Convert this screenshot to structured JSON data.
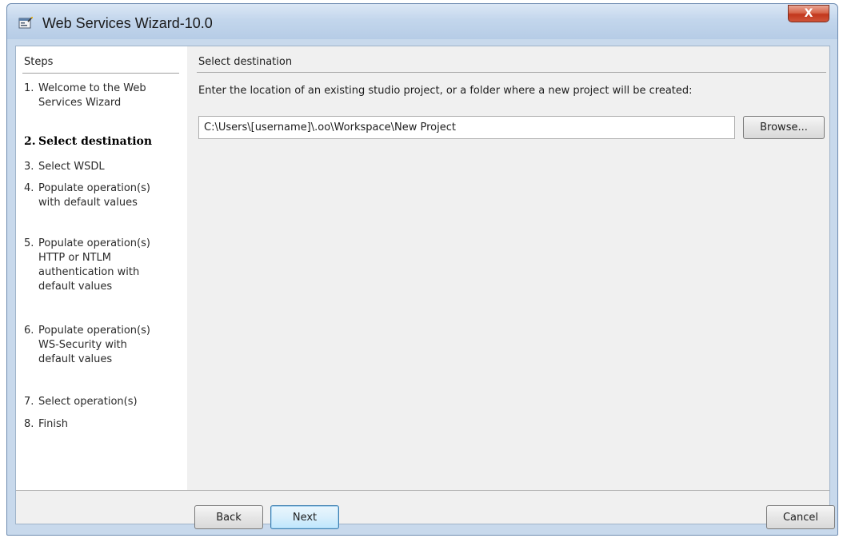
{
  "window": {
    "title": "Web Services Wizard-10.0",
    "close_glyph": "X",
    "icon": "wizard-app-icon"
  },
  "steps": {
    "header": "Steps",
    "items": [
      {
        "num": "1.",
        "label": "Welcome to the Web\nServices Wizard",
        "active": false
      },
      {
        "num": "2.",
        "label": "Select destination",
        "active": true
      },
      {
        "num": "3.",
        "label": "Select WSDL",
        "active": false
      },
      {
        "num": "4.",
        "label": "Populate operation(s)\nwith default values",
        "active": false
      },
      {
        "num": "5.",
        "label": "Populate operation(s)\nHTTP or NTLM\nauthentication with\ndefault values",
        "active": false
      },
      {
        "num": "6.",
        "label": "Populate operation(s)\nWS-Security with\ndefault values",
        "active": false
      },
      {
        "num": "7.",
        "label": "Select operation(s)",
        "active": false
      },
      {
        "num": "8.",
        "label": "Finish",
        "active": false
      }
    ]
  },
  "content": {
    "section_title": "Select destination",
    "instruction": "Enter the location of an existing studio project, or a folder where a new project will be created:",
    "path_value": "C:\\Users\\[username]\\.oo\\Workspace\\New Project",
    "browse_label": "Browse..."
  },
  "footer": {
    "back_label": "Back",
    "next_label": "Next",
    "cancel_label": "Cancel"
  }
}
